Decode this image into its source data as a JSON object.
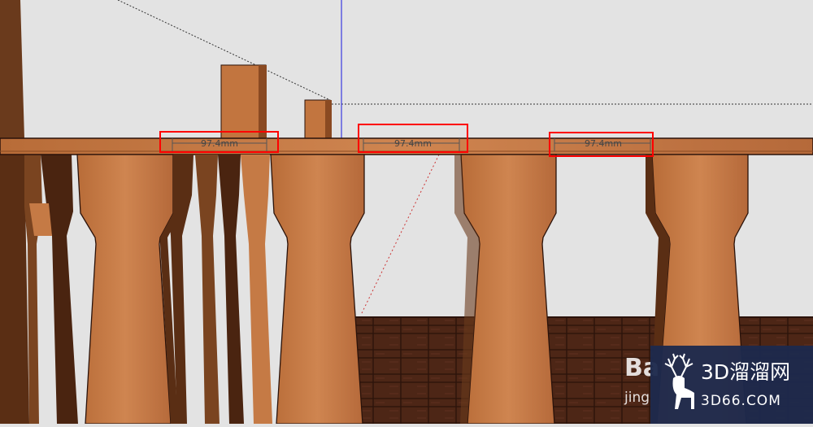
{
  "scene": {
    "background": "#e3e3e3",
    "wood_light": "#c57a45",
    "wood_dark": "#5a2e14",
    "floor": "#4a2414",
    "highlight_color": "#ff0000",
    "axis_blue": "#3a3ae0"
  },
  "dimensions": [
    {
      "label": "97.4mm"
    },
    {
      "label": "97.4mm"
    },
    {
      "label": "97.4mm"
    }
  ],
  "watermark": {
    "baidu_text": "Ba",
    "baidu_sub": "jing",
    "brand_title": "3D溜溜网",
    "brand_url": "3D66.COM",
    "icon": "deer-icon"
  }
}
